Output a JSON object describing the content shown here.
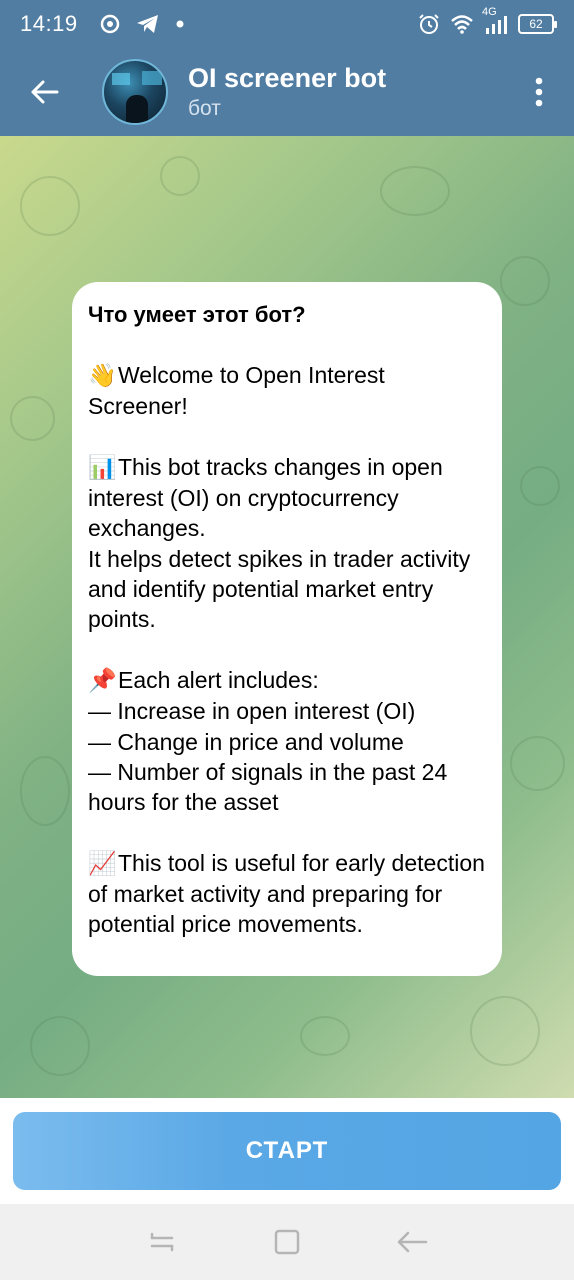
{
  "status_bar": {
    "time": "14:19",
    "left_icons": [
      "settings-circle-icon",
      "telegram-icon",
      "dot-icon"
    ],
    "right_icons": [
      "alarm-icon",
      "wifi-icon",
      "signal-4g-icon"
    ],
    "network_label": "4G",
    "battery": "62"
  },
  "header": {
    "title": "OI screener bot",
    "subtitle": "бот",
    "back_icon": "back-arrow-icon",
    "menu_icon": "more-vert-icon"
  },
  "message": {
    "title": "Что умеет этот бот?",
    "welcome_emoji": "👋",
    "welcome_text": "Welcome to Open Interest Screener!",
    "tracks_emoji": "📊",
    "tracks_text": "This bot tracks changes in open interest (OI) on cryptocurrency exchanges.",
    "helps_text": "It helps detect spikes in trader activity and identify potential market entry points.",
    "alert_emoji": "📌",
    "alert_intro": "Each alert includes:",
    "alert_items": [
      "— Increase in open interest (OI)",
      "— Change in price and volume",
      "— Number of signals in the past 24 hours for the asset"
    ],
    "useful_emoji": "📈",
    "useful_text": "This tool is useful for early detection of market activity and preparing for potential price movements."
  },
  "start_button": {
    "label": "СТАРТ"
  },
  "nav_bar": {
    "icons": [
      "recents-icon",
      "home-icon",
      "back-icon"
    ]
  },
  "colors": {
    "header_bg": "#517da2",
    "button_bg": "#54a5e4",
    "bubble_bg": "#ffffff"
  }
}
